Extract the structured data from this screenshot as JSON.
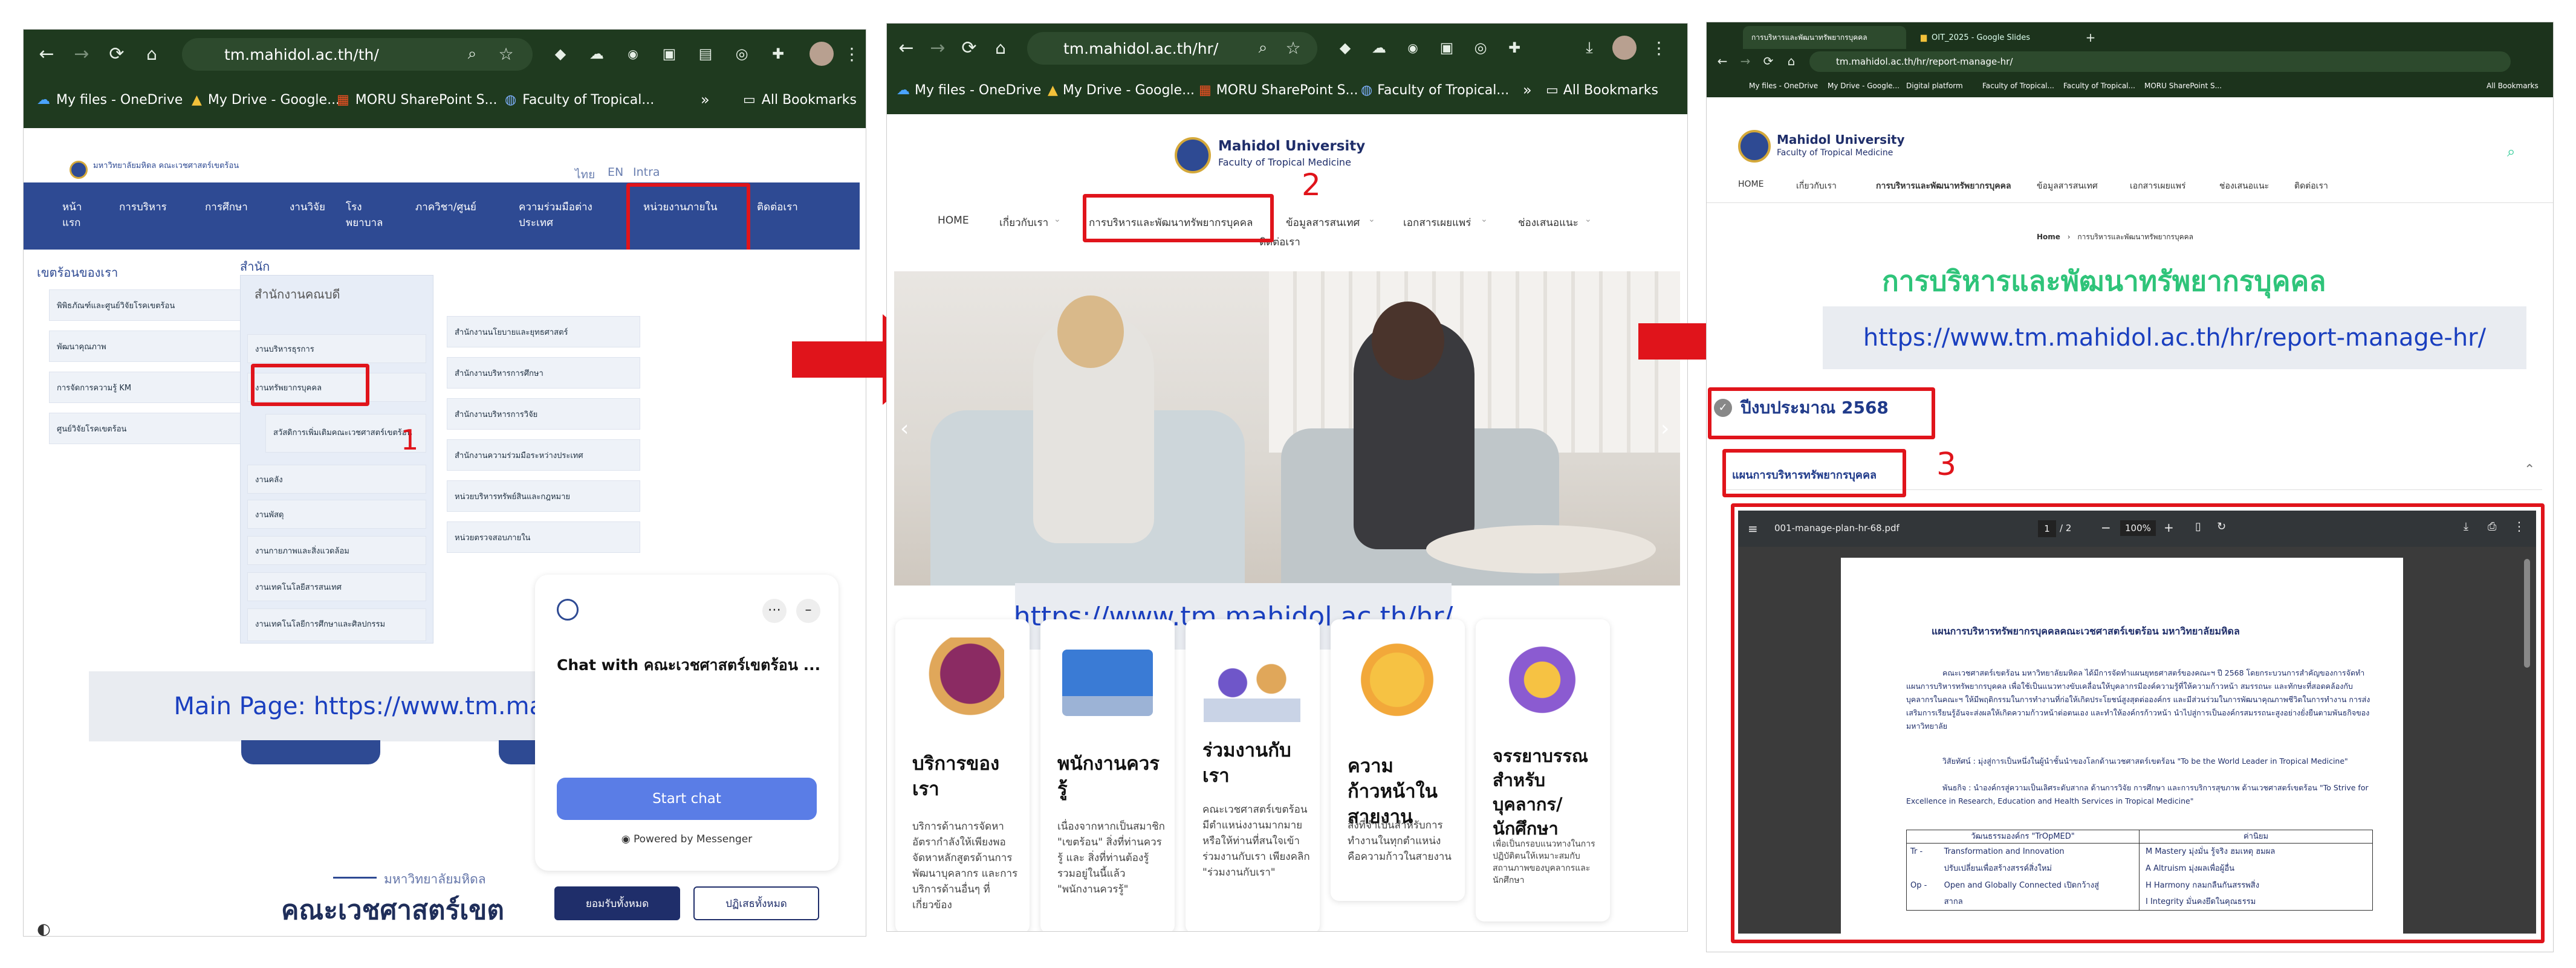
{
  "panel1": {
    "url": "tm.mahidol.ac.th/th/",
    "bookmarks": [
      "My files - OneDrive",
      "My Drive - Google...",
      "MORU SharePoint S...",
      "Faculty of Tropical...",
      "All Bookmarks"
    ],
    "site_logo": "มหาวิทยาลัยมหิดล คณะเวชศาสตร์เขตร้อน",
    "lang": [
      "ไทย",
      "EN",
      "Intra"
    ],
    "nav": [
      "หน้าแรก",
      "การบริหาร",
      "การศึกษา",
      "งานวิจัย",
      "โรงพยาบาล",
      "ภาควิชา/ศูนย์",
      "ความร่วมมือต่างประเทศ",
      "หน่วยงานภายใน",
      "ติดต่อเรา"
    ],
    "mega_left_title": "เขตร้อนของเรา",
    "mega_left": [
      "พิพิธภัณฑ์และศูนย์วิจัยโรคเขตร้อน",
      "พัฒนาคุณภาพ",
      "การจัดการความรู้ KM",
      "ศูนย์วิจัยโรคเขตร้อน"
    ],
    "mega_mid_title": "สำนัก",
    "mega_mid_head": "สำนักงานคณบดี",
    "mega_mid": [
      "งานบริหารธุรการ",
      "งานทรัพยากรบุคคล",
      "สวัสดิการเพิ่มเติมคณะเวชศาสตร์เขตร้อน",
      "งานคลัง",
      "งานพัสดุ",
      "งานกายภาพและสิ่งแวดล้อม",
      "งานเทคโนโลยีสารสนเทศ",
      "งานเทคโนโลยีการศึกษาและศิลปกรรม"
    ],
    "mega_right": [
      "สำนักงานนโยบายและยุทธศาสตร์",
      "สำนักงานบริหารการศึกษา",
      "สำนักงานบริหารการวิจัย",
      "สำนักงานความร่วมมือระหว่างประเทศ",
      "หน่วยบริหารทรัพย์สินและกฎหมาย",
      "หน่วยตรวจสอบภายใน"
    ],
    "step_label": "1",
    "caption": "Main Page: https://www.tm.mahidol.ac.th/th/",
    "chat_title": "Chat with คณะเวชศาสตร์เขตร้อน ...",
    "chat_button": "Start chat",
    "chat_powered": "Powered by Messenger",
    "faculty_sub": "มหาวิทยาลัยมหิดล",
    "faculty_title": "คณะเวชศาสตร์เขต",
    "cookie_accept": "ยอมรับทั้งหมด",
    "cookie_reject": "ปฏิเสธทั้งหมด"
  },
  "panel2": {
    "url": "tm.mahidol.ac.th/hr/",
    "bookmarks": [
      "My files - OneDrive",
      "My Drive - Google...",
      "MORU SharePoint S...",
      "Faculty of Tropical...",
      "All Bookmarks"
    ],
    "logo_title": "Mahidol University",
    "logo_sub": "Faculty of Tropical Medicine",
    "nav": [
      "HOME",
      "เกี่ยวกับเรา",
      "การบริหารและพัฒนาทรัพยากรบุคคล",
      "ข้อมูลสารสนเทศ",
      "เอกสารเผยแพร่",
      "ช่องเสนอแนะ"
    ],
    "nav_extra": "ติดต่อเรา",
    "step_label": "2",
    "caption": "https://www.tm.mahidol.ac.th/hr/",
    "cards": [
      {
        "title": "บริการของเรา",
        "text": "บริการด้านการจัดหา อัตรากำลังให้เพียงพอ จัดหาหลักสูตรด้านการพัฒนาบุคลากร และการบริการด้านอื่นๆ ที่เกี่ยวข้อง"
      },
      {
        "title": "พนักงานควรรู้",
        "text": "เนื่องจากหากเป็นสมาชิก \"เขตร้อน\" สิ่งที่ท่านควรรู้ และ สิ่งที่ท่านต้องรู้ รวมอยู่ในนี้แล้ว \"พนักงานควรรู้\""
      },
      {
        "title": "ร่วมงานกับเรา",
        "text": "คณะเวชศาสตร์เขตร้อน มีตำแหน่งงานมากมาย หรือให้ท่านที่สนใจเข้าร่วมงานกับเรา เพียงคลิก \"ร่วมงานกับเรา\""
      },
      {
        "title": "ความก้าวหน้าในสายงาน",
        "text": "สิ่งที่จำเป็นสำหรับการทำงานในทุกตำแหน่ง คือความก้าวในสายงาน"
      },
      {
        "title": "จรรยาบรรณสำหรับบุคลากร/นักศึกษา",
        "text": "เพื่อเป็นกรอบแนวทางในการปฏิบัติตนให้เหมาะสมกับสถานภาพของบุคลากรและนักศึกษา"
      }
    ]
  },
  "panel3": {
    "tab1": "การบริหารและพัฒนาทรัพยากรบุคคล",
    "tab2": "OIT_2025 - Google Slides",
    "url": "tm.mahidol.ac.th/hr/report-manage-hr/",
    "bookmarks": [
      "My files - OneDrive",
      "My Drive - Google...",
      "Digital platform",
      "Faculty of Tropical...",
      "Faculty of Tropical...",
      "MORU SharePoint S...",
      "All Bookmarks"
    ],
    "logo_title": "Mahidol University",
    "logo_sub": "Faculty of Tropical Medicine",
    "nav": [
      "HOME",
      "เกี่ยวกับเรา",
      "การบริหารและพัฒนาทรัพยากรบุคคล",
      "ข้อมูลสารสนเทศ",
      "เอกสารเผยแพร่",
      "ช่องเสนอแนะ",
      "ติดต่อเรา"
    ],
    "breadcrumb_home": "Home",
    "breadcrumb_current": "การบริหารและพัฒนาทรัพยากรบุคคล",
    "page_title": "การบริหารและพัฒนาทรัพยากรบุคคล",
    "caption": "https://www.tm.mahidol.ac.th/hr/report-manage-hr/",
    "year": "ปีงบประมาณ 2568",
    "section": "แผนการบริหารทรัพยากรบุคคล",
    "step_label": "3",
    "pdf_name": "001-manage-plan-hr-68.pdf",
    "pdf_page": "1",
    "pdf_total": "/ 2",
    "pdf_zoom": "100%",
    "doc_title": "แผนการบริหารทรัพยากรบุคคลคณะเวชศาสตร์เขตร้อน มหาวิทยาลัยมหิดล",
    "doc_p1": "คณะเวชศาสตร์เขตร้อน มหาวิทยาลัยมหิดล ได้มีการจัดทำแผนยุทธศาสตร์ของคณะฯ ปี 2568 โดยกระบวนการสำคัญของการจัดทำแผนการบริหารทรัพยากรบุคคล เพื่อใช้เป็นแนวทางขับเคลื่อนให้บุคลากรมีองค์ความรู้ที่ให้ความก้าวหน้า สมรรถนะ และทักษะที่สอดคล้องกับบุคลากรในคณะฯ ให้มีพฤติกรรมในการทำงานที่ก่อให้เกิดประโยชน์สูงสุดต่อองค์กร และมีส่วนร่วมในการพัฒนาคุณภาพชีวิตในการทำงาน การส่งเสริมการเรียนรู้อันจะส่งผลให้เกิดความก้าวหน้าต่อตนเอง และทำให้องค์กรก้าวหน้า นำไปสู่การเป็นองค์กรสมรรถนะสูงอย่างยั่งยืนตามพันธกิจของมหาวิทยาลัย",
    "doc_p2": "วิสัยทัศน์ : มุ่งสู่การเป็นหนึ่งในผู้นำชั้นนำของโลกด้านเวชศาสตร์เขตร้อน \"To be the World Leader in Tropical Medicine\"",
    "doc_p3": "พันธกิจ : นำองค์กรสู่ความเป็นเลิศระดับสากล ด้านการวิจัย การศึกษา และการบริการสุขภาพ ด้านเวชศาสตร์เขตร้อน \"To Strive for Excellence in Research, Education and Health Services in Tropical Medicine\"",
    "table_head": [
      "วัฒนธรรมองค์กร \"TrOpMED\"",
      "ค่านิยม"
    ],
    "table_rows": [
      [
        "Tr -",
        "Transformation and Innovation",
        "M  Mastery มุ่งมั่น รู้จริง ฮมเหตุ ฮมผล"
      ],
      [
        "",
        "ปรับเปลี่ยนเพื่อสร้างสรรค์สิ่งใหม่",
        "A  Altruism มุ่งผลเพื่อผู้อื่น"
      ],
      [
        "Op -",
        "Open and Globally Connected เปิดกว้างสู่",
        "H  Harmony กลมกลืนกันสรรพสิ่ง"
      ],
      [
        "",
        "สากล",
        "I  Integrity มั่นคงยึดในคุณธรรม"
      ]
    ]
  }
}
